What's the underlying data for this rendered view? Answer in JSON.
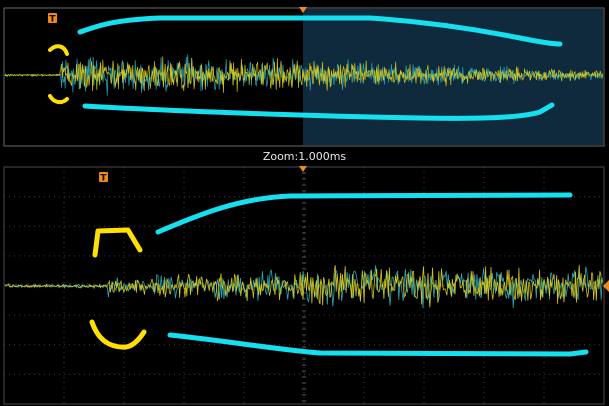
{
  "zoom_label": "Zoom:1.000ms",
  "trigger_marker": "T",
  "colors": {
    "background": "#000000",
    "overview_border": "#6a6a6a",
    "overview_highlight": "#0e2a3c",
    "grid": "#3a3a3a",
    "channel_1_trace": "#d4c41a",
    "channel_2_trace": "#2aa7b8",
    "trigger_marker": "#f08a1c",
    "annotation_envelope": "#14e0f0",
    "annotation_bracket": "#ffe000"
  },
  "icons": {
    "trigger_marker": "trigger-t-icon",
    "trigger_position": "triangle-down-icon",
    "trigger_level": "triangle-left-icon"
  }
}
